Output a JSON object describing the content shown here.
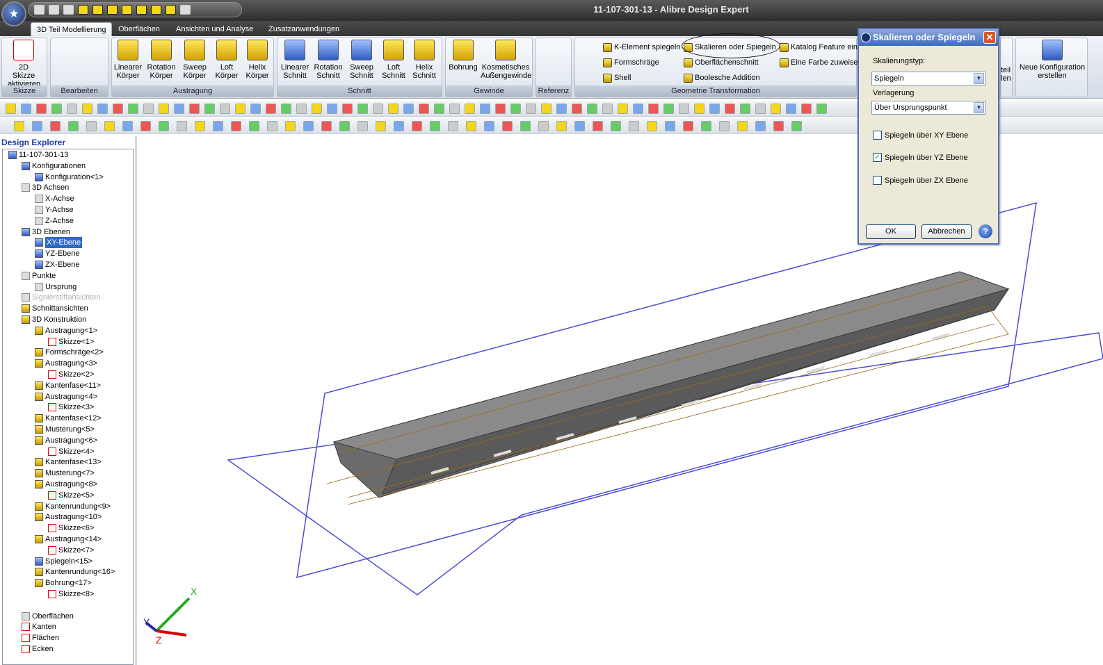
{
  "window": {
    "title": "11-107-301-13 - Alibre Design Expert"
  },
  "tabs": [
    "3D Teil Modellierung",
    "Oberflächen",
    "Ansichten und Analyse",
    "Zusatzanwendungen"
  ],
  "ribbon": {
    "groups": {
      "skizze": "Skizze",
      "bearbeiten": "Bearbeiten",
      "austragung": "Austragung",
      "schnitt": "Schnitt",
      "gewinde": "Gewinde",
      "referenz": "Referenz",
      "geometrie": "Geometrie Transformation"
    },
    "buttons": {
      "skizze_l1": "2D Skizze",
      "skizze_l2": "aktivieren",
      "lin_k_l1": "Linearer",
      "lin_k_l2": "Körper",
      "rot_k_l1": "Rotation",
      "rot_k_l2": "Körper",
      "sw_k_l1": "Sweep",
      "sw_k_l2": "Körper",
      "loft_k_l1": "Loft",
      "loft_k_l2": "Körper",
      "helix_k_l1": "Helix",
      "helix_k_l2": "Körper",
      "lin_s_l1": "Linearer",
      "lin_s_l2": "Schnitt",
      "rot_s_l1": "Rotation",
      "rot_s_l2": "Schnitt",
      "sw_s_l1": "Sweep",
      "sw_s_l2": "Schnitt",
      "loft_s_l1": "Loft",
      "loft_s_l2": "Schnitt",
      "helix_s_l1": "Helix",
      "helix_s_l2": "Schnitt",
      "bohrung": "Bohrung",
      "kosm_l1": "Kosmetisches",
      "kosm_l2": "Außengewinde",
      "kelement": "K-Element spiegeln",
      "formschraege": "Formschräge",
      "shell": "Shell",
      "skalieren": "Skalieren oder Spiegeln",
      "oberflaechenschnitt": "Oberflächenschnitt",
      "boolesche": "Boolesche Addition",
      "katalog": "Katalog Feature ein",
      "farbe": "Eine Farbe zuweisen",
      "teil_l1": "teil",
      "teil_l2": "len",
      "neue_l1": "Neue Konfiguration",
      "neue_l2": "erstellen"
    }
  },
  "explorer": {
    "title": "Design Explorer",
    "nodes": {
      "root": "11-107-301-13",
      "konfigurationen": "Konfigurationen",
      "konfiguration1": "Konfiguration<1>",
      "achsen": "3D Achsen",
      "xachse": "X-Achse",
      "yachse": "Y-Achse",
      "zachse": "Z-Achse",
      "ebenen": "3D Ebenen",
      "xyebene": "XY-Ebene",
      "yzebene": "YZ-Ebene",
      "zxebene": "ZX-Ebene",
      "punkte": "Punkte",
      "ursprung": "Ursprung",
      "signier": "Signierstiftansichten",
      "schnittansichten": "Schnittansichten",
      "konstruktion": "3D Konstruktion",
      "a1": "Austragung<1>",
      "s1": "Skizze<1>",
      "f2": "Formschräge<2>",
      "a3": "Austragung<3>",
      "s2": "Skizze<2>",
      "k11": "Kantenfase<11>",
      "a4": "Austragung<4>",
      "s3": "Skizze<3>",
      "k12": "Kantenfase<12>",
      "m5": "Musterung<5>",
      "a6": "Austragung<6>",
      "s4": "Skizze<4>",
      "k13": "Kantenfase<13>",
      "m7": "Musterung<7>",
      "a8": "Austragung<8>",
      "s5": "Skizze<5>",
      "kr9": "Kantenrundung<9>",
      "a10": "Austragung<10>",
      "s6": "Skizze<6>",
      "a14": "Austragung<14>",
      "s7": "Skizze<7>",
      "sp15": "Spiegeln<15>",
      "kr16": "Kantenrundung<16>",
      "b17": "Bohrung<17>",
      "s8": "Skizze<8>",
      "oberflaechen": "Oberflächen",
      "kanten": "Kanten",
      "flaechen": "Flächen",
      "ecken": "Ecken"
    }
  },
  "triad": {
    "x": "X",
    "y": "Y",
    "z": "Z"
  },
  "dialog": {
    "title": "Skalieren oder Spiegeln",
    "type_label": "Skalierungstyp:",
    "type_value": "Spiegeln",
    "verlagerung_label": "Verlagerung",
    "verlagerung_value": "Über Ursprungspunkt",
    "checkboxes": [
      {
        "label": "Spiegeln über XY Ebene",
        "checked": false
      },
      {
        "label": "Spiegeln über YZ Ebene",
        "checked": true
      },
      {
        "label": "Spiegeln über ZX Ebene",
        "checked": false
      }
    ],
    "ok": "OK",
    "cancel": "Abbrechen",
    "help": "?"
  },
  "colors": {
    "plane": "#4b4bd8",
    "solid": "#6e6e6e",
    "wire": "#9a6a1a",
    "accent": "#316ac5"
  }
}
